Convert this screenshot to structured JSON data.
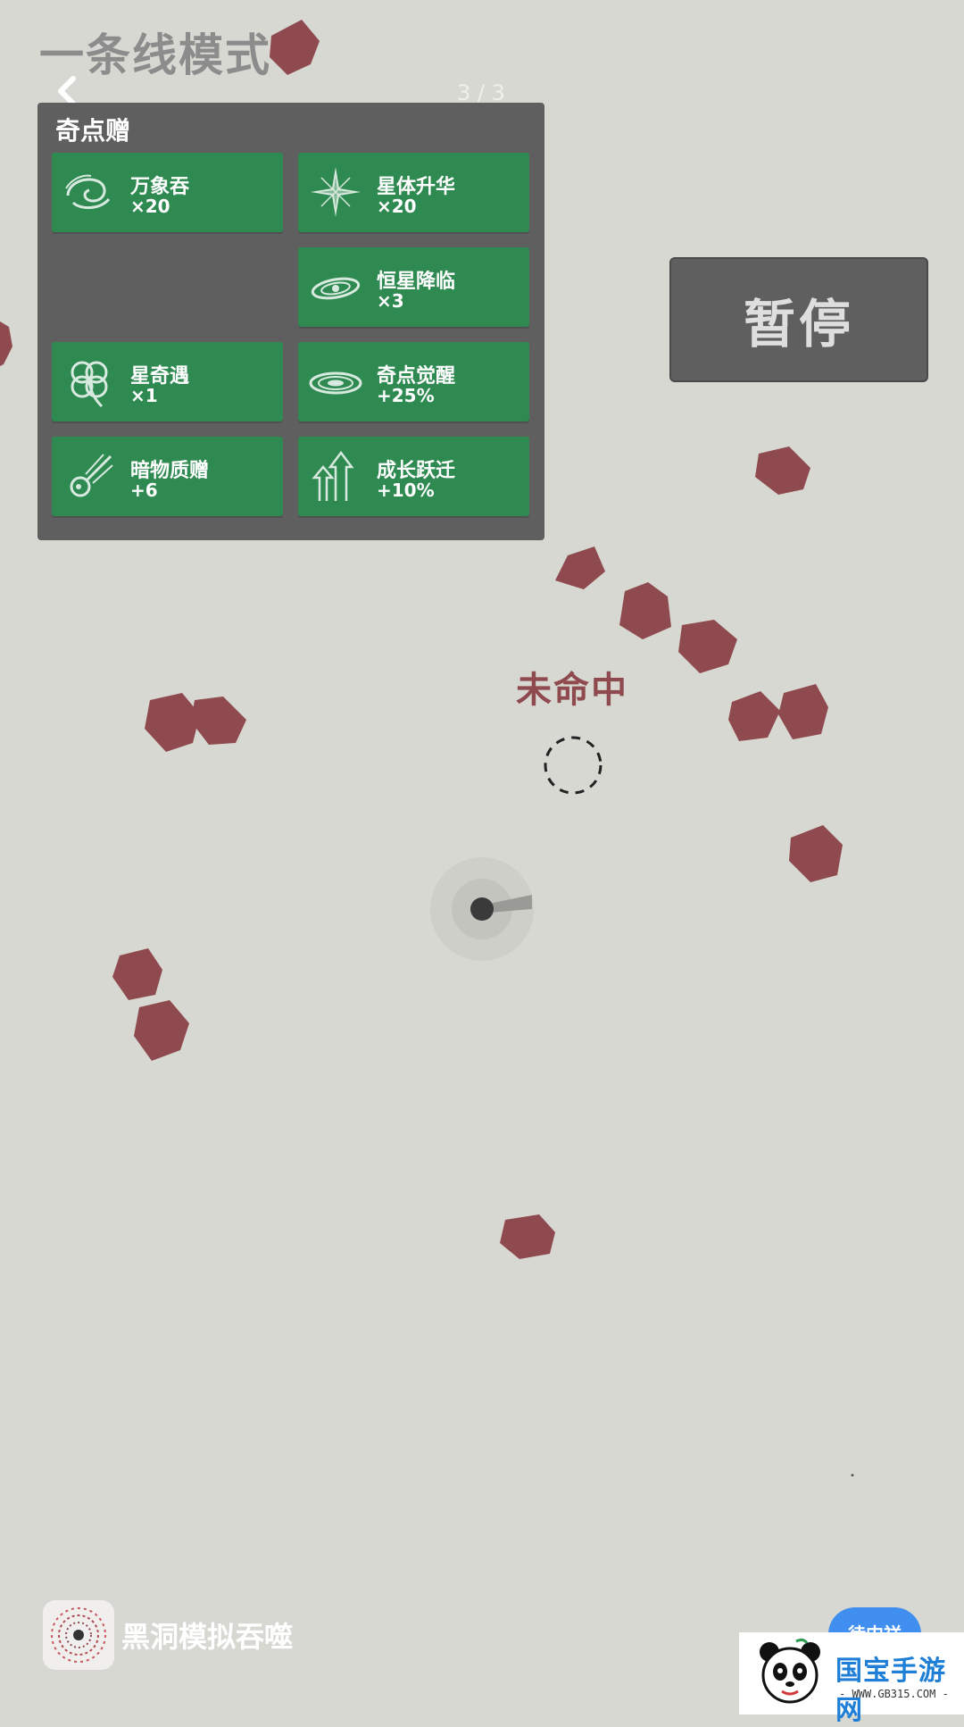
{
  "header": {
    "mode_title": "一条线模式",
    "page_indicator": "3 / 3"
  },
  "panel": {
    "title": "奇点赠",
    "cards": [
      {
        "name": "万象吞",
        "amount": "×20",
        "icon": "galaxy-swirl-icon"
      },
      {
        "name": "星体升华",
        "amount": "×20",
        "icon": "starburst-icon"
      },
      {
        "name": "恒星降临",
        "amount": "×3",
        "icon": "ringed-planet-icon"
      },
      {
        "name": "星奇遇",
        "amount": "×1",
        "icon": "clover-icon"
      },
      {
        "name": "奇点觉醒",
        "amount": "+25%",
        "icon": "disk-galaxy-icon"
      },
      {
        "name": "暗物质赠",
        "amount": "+6",
        "icon": "meteor-icon"
      },
      {
        "name": "成长跃迁",
        "amount": "+10%",
        "icon": "growth-arrows-icon"
      }
    ]
  },
  "controls": {
    "pause_label": "暂停"
  },
  "game": {
    "status_text": "未命中",
    "enemy_color": "#8e4a4e",
    "black_hole_color": "#3a3a3a"
  },
  "footer": {
    "app_name": "黑洞模拟吞噬",
    "button_label": "待内祥"
  },
  "watermark": {
    "site_name": "国宝手游网",
    "url": "- WWW.GB315.COM -"
  },
  "colors": {
    "background": "#d8d8d2",
    "panel": "#5f5f5f",
    "card": "#2f8a52"
  }
}
